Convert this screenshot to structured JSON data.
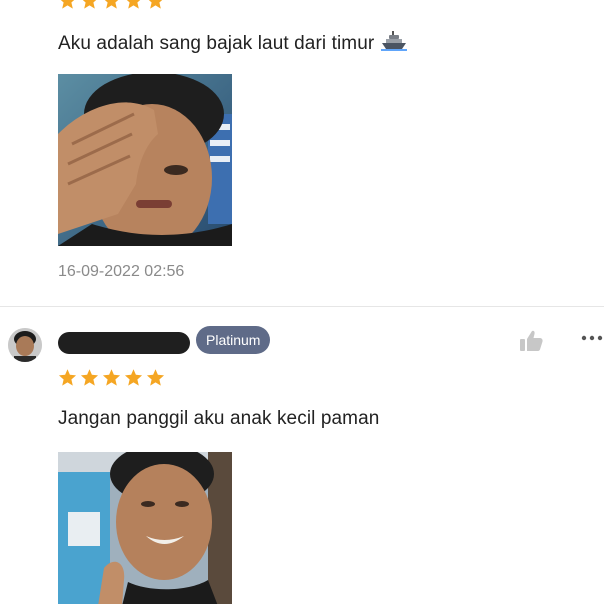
{
  "reviews": [
    {
      "rating": 5,
      "text": "Aku adalah sang bajak laut dari timur",
      "trailing_emoji": "ship-icon",
      "timestamp": "16-09-2022 02:56"
    },
    {
      "username": "",
      "tier_badge": "Platinum",
      "rating": 5,
      "text": "Jangan panggil aku anak kecil paman"
    }
  ],
  "colors": {
    "star": "#f5a623",
    "badge_bg": "#5f6b88",
    "timestamp": "#8a8a8a",
    "divider": "#e6e6e6"
  },
  "icons": [
    "star-icon",
    "ship-icon",
    "thumbs-up-icon",
    "more-options-icon"
  ]
}
